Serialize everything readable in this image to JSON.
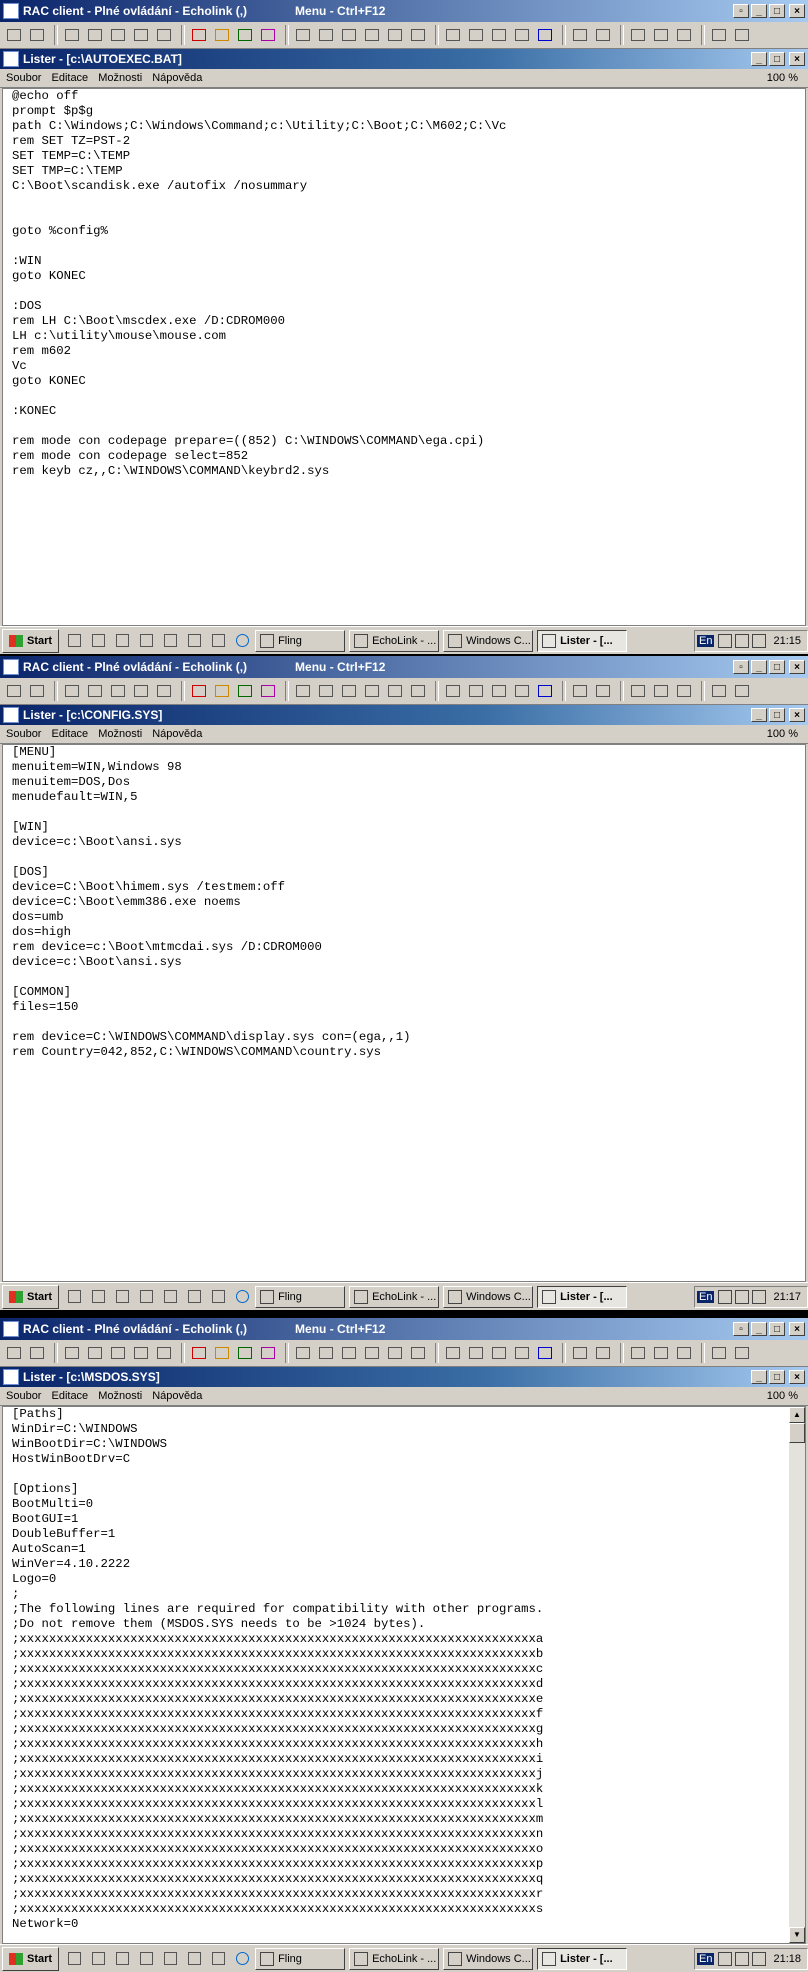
{
  "outer_title": "RAC client - Plné ovládání - Echolink (,)",
  "outer_hint": "Menu - Ctrl+F12",
  "menu": [
    "Soubor",
    "Editace",
    "Možnosti",
    "Nápověda"
  ],
  "zoom": "100 %",
  "taskbar": {
    "start": "Start",
    "tasks": [
      "Fling",
      "EchoLink - ...",
      "Windows C...",
      "Lister - [..."
    ],
    "lang": "En"
  },
  "windows": [
    {
      "lister_title": "Lister - [c:\\AUTOEXEC.BAT]",
      "content": "@echo off\nprompt $p$g\npath C:\\Windows;C:\\Windows\\Command;c:\\Utility;C:\\Boot;C:\\M602;C:\\Vc\nrem SET TZ=PST-2\nSET TEMP=C:\\TEMP\nSET TMP=C:\\TEMP\nC:\\Boot\\scandisk.exe /autofix /nosummary\n\n\ngoto %config%\n\n:WIN\ngoto KONEC\n\n:DOS\nrem LH C:\\Boot\\mscdex.exe /D:CDROM000\nLH c:\\utility\\mouse\\mouse.com\nrem m602\nVc\ngoto KONEC\n\n:KONEC\n\nrem mode con codepage prepare=((852) C:\\WINDOWS\\COMMAND\\ega.cpi)\nrem mode con codepage select=852\nrem keyb cz,,C:\\WINDOWS\\COMMAND\\keybrd2.sys",
      "clock": "21:15"
    },
    {
      "lister_title": "Lister - [c:\\CONFIG.SYS]",
      "content": "[MENU]\nmenuitem=WIN,Windows 98\nmenuitem=DOS,Dos\nmenudefault=WIN,5\n\n[WIN]\ndevice=c:\\Boot\\ansi.sys\n\n[DOS]\ndevice=C:\\Boot\\himem.sys /testmem:off\ndevice=C:\\Boot\\emm386.exe noems\ndos=umb\ndos=high\nrem device=c:\\Boot\\mtmcdai.sys /D:CDROM000\ndevice=c:\\Boot\\ansi.sys\n\n[COMMON]\nfiles=150\n\nrem device=C:\\WINDOWS\\COMMAND\\display.sys con=(ega,,1)\nrem Country=042,852,C:\\WINDOWS\\COMMAND\\country.sys",
      "clock": "21:17"
    },
    {
      "lister_title": "Lister - [c:\\MSDOS.SYS]",
      "content": "[Paths]\nWinDir=C:\\WINDOWS\nWinBootDir=C:\\WINDOWS\nHostWinBootDrv=C\n\n[Options]\nBootMulti=0\nBootGUI=1\nDoubleBuffer=1\nAutoScan=1\nWinVer=4.10.2222\nLogo=0\n;\n;The following lines are required for compatibility with other programs.\n;Do not remove them (MSDOS.SYS needs to be >1024 bytes).\n;xxxxxxxxxxxxxxxxxxxxxxxxxxxxxxxxxxxxxxxxxxxxxxxxxxxxxxxxxxxxxxxxxxxxxxa\n;xxxxxxxxxxxxxxxxxxxxxxxxxxxxxxxxxxxxxxxxxxxxxxxxxxxxxxxxxxxxxxxxxxxxxxb\n;xxxxxxxxxxxxxxxxxxxxxxxxxxxxxxxxxxxxxxxxxxxxxxxxxxxxxxxxxxxxxxxxxxxxxxc\n;xxxxxxxxxxxxxxxxxxxxxxxxxxxxxxxxxxxxxxxxxxxxxxxxxxxxxxxxxxxxxxxxxxxxxxd\n;xxxxxxxxxxxxxxxxxxxxxxxxxxxxxxxxxxxxxxxxxxxxxxxxxxxxxxxxxxxxxxxxxxxxxxe\n;xxxxxxxxxxxxxxxxxxxxxxxxxxxxxxxxxxxxxxxxxxxxxxxxxxxxxxxxxxxxxxxxxxxxxxf\n;xxxxxxxxxxxxxxxxxxxxxxxxxxxxxxxxxxxxxxxxxxxxxxxxxxxxxxxxxxxxxxxxxxxxxxg\n;xxxxxxxxxxxxxxxxxxxxxxxxxxxxxxxxxxxxxxxxxxxxxxxxxxxxxxxxxxxxxxxxxxxxxxh\n;xxxxxxxxxxxxxxxxxxxxxxxxxxxxxxxxxxxxxxxxxxxxxxxxxxxxxxxxxxxxxxxxxxxxxxi\n;xxxxxxxxxxxxxxxxxxxxxxxxxxxxxxxxxxxxxxxxxxxxxxxxxxxxxxxxxxxxxxxxxxxxxxj\n;xxxxxxxxxxxxxxxxxxxxxxxxxxxxxxxxxxxxxxxxxxxxxxxxxxxxxxxxxxxxxxxxxxxxxxk\n;xxxxxxxxxxxxxxxxxxxxxxxxxxxxxxxxxxxxxxxxxxxxxxxxxxxxxxxxxxxxxxxxxxxxxxl\n;xxxxxxxxxxxxxxxxxxxxxxxxxxxxxxxxxxxxxxxxxxxxxxxxxxxxxxxxxxxxxxxxxxxxxxm\n;xxxxxxxxxxxxxxxxxxxxxxxxxxxxxxxxxxxxxxxxxxxxxxxxxxxxxxxxxxxxxxxxxxxxxxn\n;xxxxxxxxxxxxxxxxxxxxxxxxxxxxxxxxxxxxxxxxxxxxxxxxxxxxxxxxxxxxxxxxxxxxxxo\n;xxxxxxxxxxxxxxxxxxxxxxxxxxxxxxxxxxxxxxxxxxxxxxxxxxxxxxxxxxxxxxxxxxxxxxp\n;xxxxxxxxxxxxxxxxxxxxxxxxxxxxxxxxxxxxxxxxxxxxxxxxxxxxxxxxxxxxxxxxxxxxxxq\n;xxxxxxxxxxxxxxxxxxxxxxxxxxxxxxxxxxxxxxxxxxxxxxxxxxxxxxxxxxxxxxxxxxxxxxr\n;xxxxxxxxxxxxxxxxxxxxxxxxxxxxxxxxxxxxxxxxxxxxxxxxxxxxxxxxxxxxxxxxxxxxxxs\nNetwork=0",
      "clock": "21:18"
    }
  ]
}
